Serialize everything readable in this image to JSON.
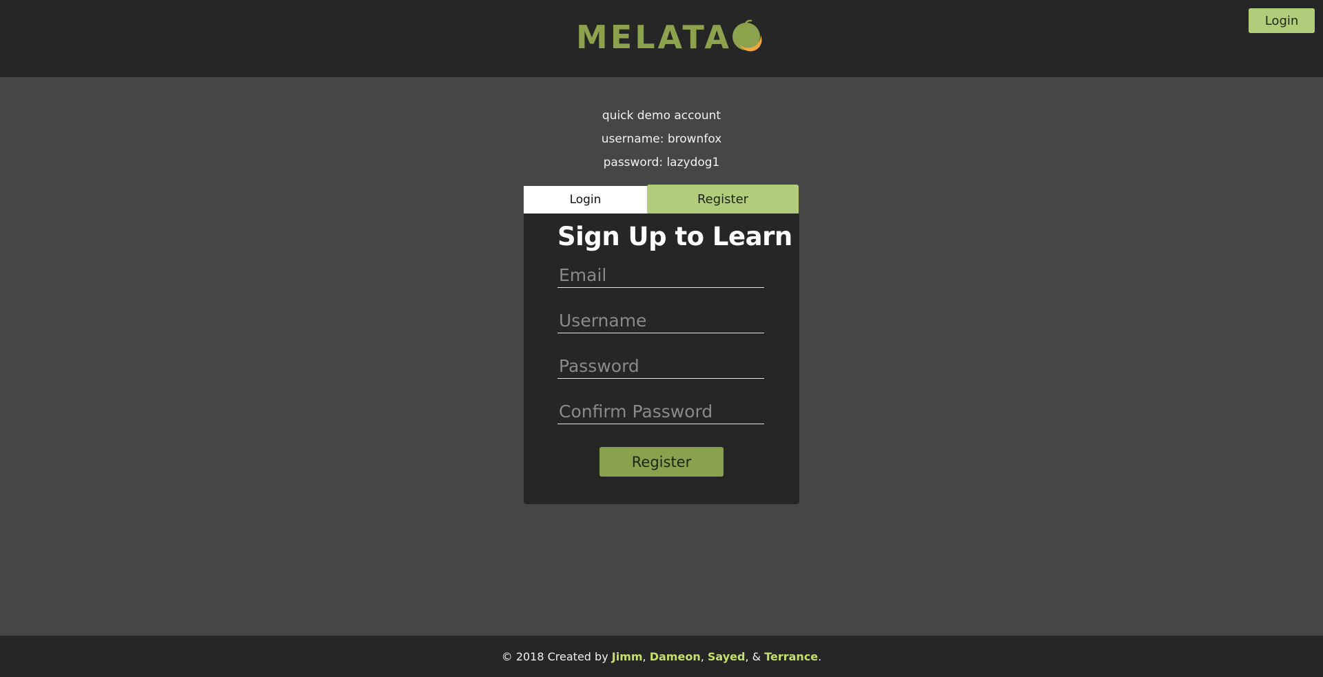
{
  "header": {
    "logo_text": "MELATA",
    "logo_icon": "melon-fruit-icon",
    "login_button": "Login"
  },
  "demo": {
    "line1": "quick demo account",
    "line2": "username: brownfox",
    "line3": "password: lazydog1"
  },
  "tabs": {
    "login": "Login",
    "register": "Register"
  },
  "form": {
    "title": "Sign Up to Learn",
    "email_placeholder": "Email",
    "username_placeholder": "Username",
    "password_placeholder": "Password",
    "confirm_placeholder": "Confirm Password",
    "submit": "Register"
  },
  "footer": {
    "prefix": "© 2018 Created by",
    "author1": "Jimm",
    "author2": "Dameon",
    "author3": "Sayed",
    "author4": "Terrance",
    "sep1": ",",
    "sep2": ",",
    "sep3": ", &",
    "suffix": "."
  },
  "colors": {
    "accent": "#b1cc7a",
    "brand": "#8da24c",
    "link": "#c3e06a"
  }
}
